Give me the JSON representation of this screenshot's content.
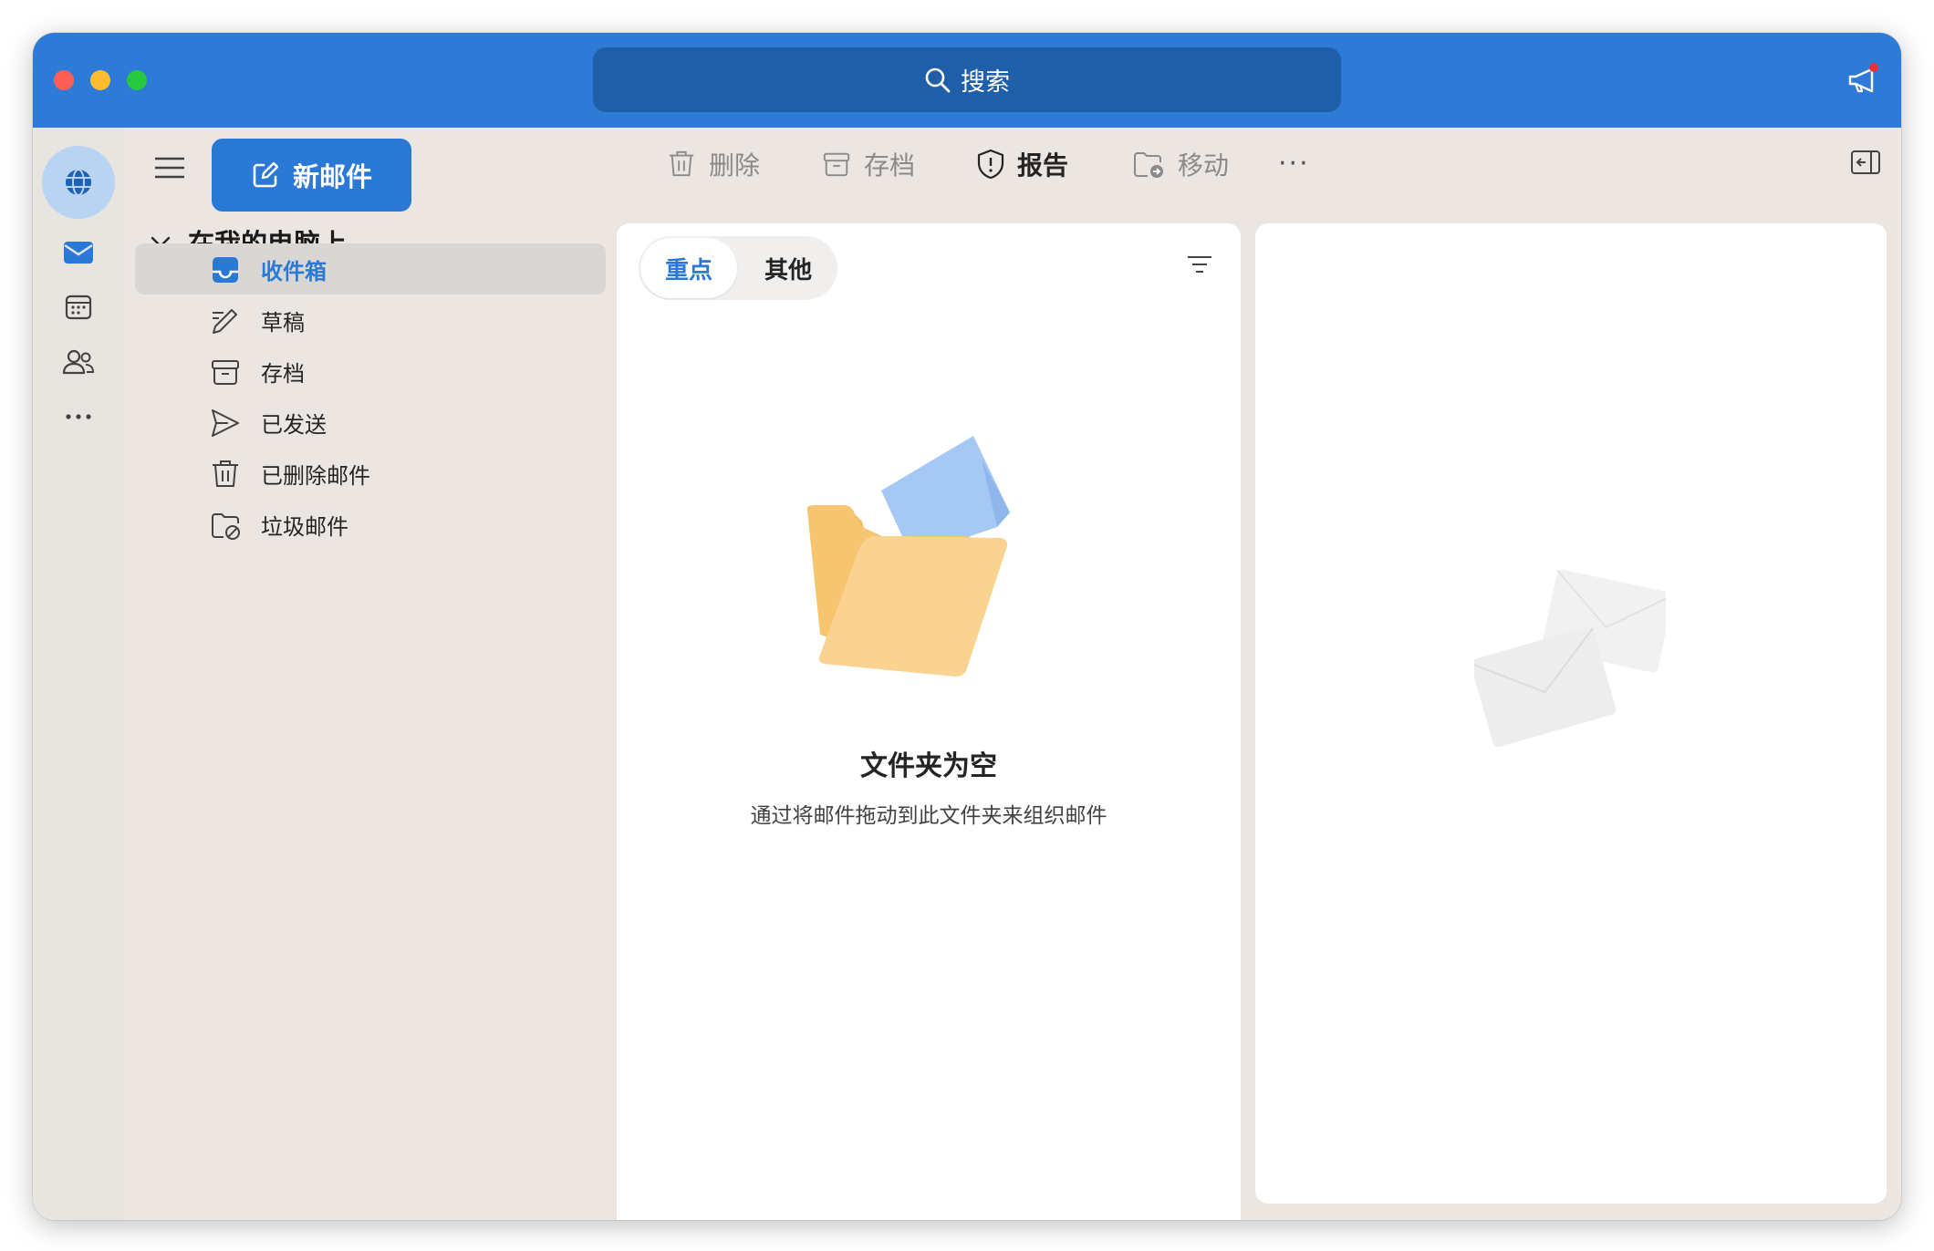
{
  "search": {
    "label": "搜索"
  },
  "rail": {
    "items": [
      "globe-icon",
      "mail-icon",
      "calendar-icon",
      "people-icon",
      "more-icon"
    ]
  },
  "compose": {
    "label": "新邮件"
  },
  "account": {
    "name": "在我的电脑上"
  },
  "folders": [
    {
      "label": "收件箱",
      "icon": "inbox-icon",
      "selected": true
    },
    {
      "label": "草稿",
      "icon": "drafts-icon"
    },
    {
      "label": "存档",
      "icon": "archive-icon"
    },
    {
      "label": "已发送",
      "icon": "sent-icon"
    },
    {
      "label": "已删除邮件",
      "icon": "trash-icon"
    },
    {
      "label": "垃圾邮件",
      "icon": "junk-icon"
    }
  ],
  "toolbar": {
    "delete": "删除",
    "archive": "存档",
    "report": "报告",
    "move": "移动",
    "more": "···"
  },
  "list": {
    "tabs": {
      "focused": "重点",
      "other": "其他"
    },
    "empty_title": "文件夹为空",
    "empty_subtitle": "通过将邮件拖动到此文件夹来组织邮件"
  },
  "colors": {
    "accent": "#2b79d6",
    "titlebar": "#2d7bd6",
    "search_bg": "#1f5ea8"
  }
}
